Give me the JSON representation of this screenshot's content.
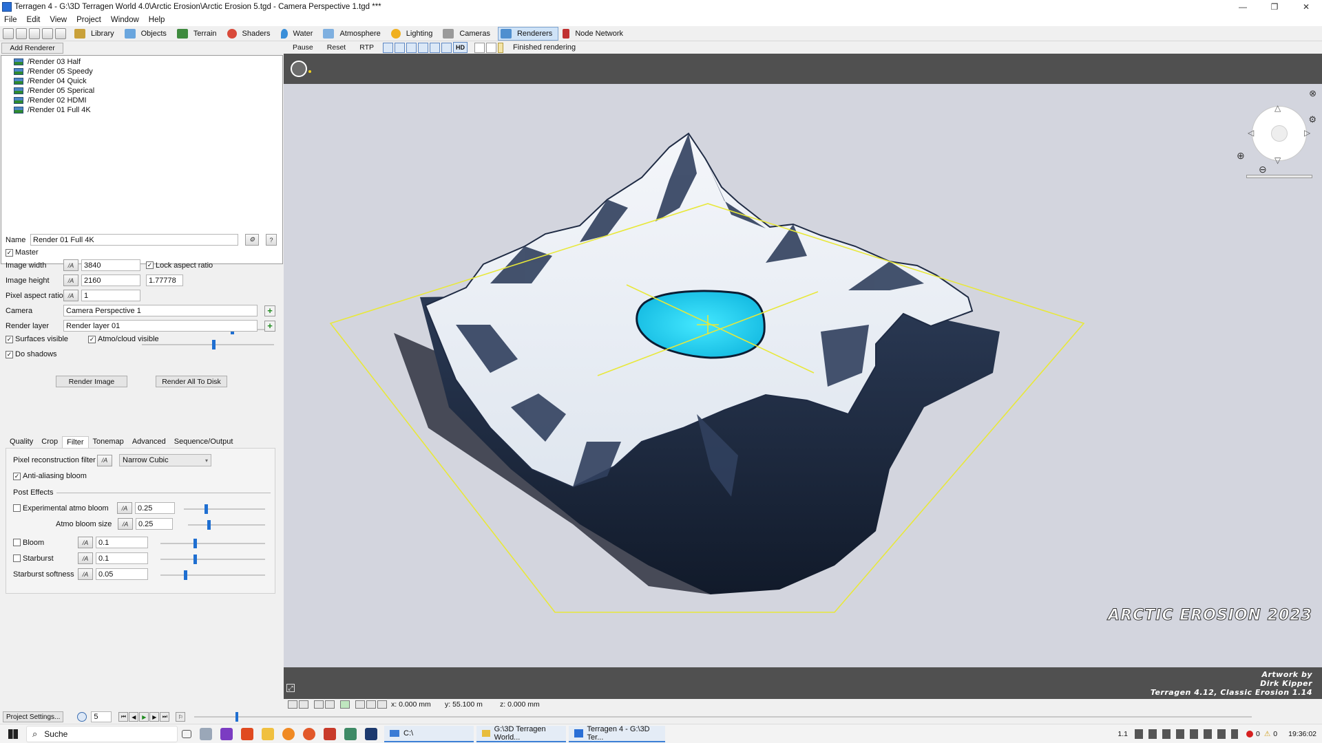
{
  "window": {
    "title": "Terragen 4 - G:\\3D Terragen World 4.0\\Arctic Erosion\\Arctic Erosion 5.tgd - Camera Perspective 1.tgd ***",
    "controls": [
      "—",
      "❐",
      "✕"
    ]
  },
  "menu": [
    "File",
    "Edit",
    "View",
    "Project",
    "Window",
    "Help"
  ],
  "toolbar": {
    "tabs": [
      {
        "label": "Library",
        "icon": "library-icon",
        "color": "#c9a13a"
      },
      {
        "label": "Objects",
        "icon": "objects-icon",
        "color": "#6aa6de"
      },
      {
        "label": "Terrain",
        "icon": "terrain-icon",
        "color": "#3e8a3e"
      },
      {
        "label": "Shaders",
        "icon": "shaders-icon",
        "color": "#d94a3a"
      },
      {
        "label": "Water",
        "icon": "water-icon",
        "color": "#3a8fd9"
      },
      {
        "label": "Atmosphere",
        "icon": "atmosphere-icon",
        "color": "#7fb0e0"
      },
      {
        "label": "Lighting",
        "icon": "lighting-icon",
        "color": "#f0b020"
      },
      {
        "label": "Cameras",
        "icon": "cameras-icon",
        "color": "#9a9a9a"
      },
      {
        "label": "Renderers",
        "icon": "renderers-icon",
        "color": "#4f8fcf",
        "active": true
      },
      {
        "label": "Node Network",
        "icon": "node-network-icon",
        "color": "#c03030"
      }
    ]
  },
  "left": {
    "add_renderer": "Add Renderer",
    "renderers": [
      "/Render 03 Half",
      "/Render 05 Speedy",
      "/Render 04 Quick",
      "/Render 05 Sperical",
      "/Render 02 HDMI",
      "/Render 01 Full 4K"
    ],
    "name_label": "Name",
    "name_value": "Render 01 Full 4K",
    "master_label": "Master",
    "image_width_label": "Image width",
    "image_width": "3840",
    "lock_aspect_label": "Lock aspect ratio",
    "image_height_label": "Image height",
    "image_height": "2160",
    "aspect_value": "1.77778",
    "pixel_aspect_label": "Pixel aspect ratio",
    "pixel_aspect": "1",
    "camera_label": "Camera",
    "camera_value": "Camera Perspective 1",
    "render_layer_label": "Render layer",
    "render_layer_value": "Render layer 01",
    "surfaces_label": "Surfaces visible",
    "atmo_label": "Atmo/cloud visible",
    "shadows_label": "Do shadows",
    "render_image": "Render Image",
    "render_all": "Render All To Disk",
    "tabs": [
      "Quality",
      "Crop",
      "Filter",
      "Tonemap",
      "Advanced",
      "Sequence/Output"
    ],
    "active_tab": "Filter",
    "filter": {
      "pixel_filter_label": "Pixel reconstruction filter",
      "pixel_filter_value": "Narrow Cubic",
      "aa_bloom_label": "Anti-aliasing bloom",
      "post_effects": "Post Effects",
      "exp_atmo_label": "Experimental atmo bloom",
      "exp_atmo_value": "0.25",
      "atmo_size_label": "Atmo bloom size",
      "atmo_size_value": "0.25",
      "bloom_label": "Bloom",
      "bloom_value": "0.1",
      "starburst_label": "Starburst",
      "starburst_value": "0.1",
      "starburst_soft_label": "Starburst softness",
      "starburst_soft_value": "0.05"
    }
  },
  "viewport": {
    "pause": "Pause",
    "reset": "Reset",
    "rtp": "RTP",
    "hd": "HD",
    "status": "Finished rendering",
    "art_title": "ARCTIC EROSION 2023",
    "art_credit_1": "Artwork by",
    "art_credit_2": "Dirk Kipper",
    "art_credit_3": "Terragen 4.12, Classic Erosion 1.14",
    "coord_x": "x: 0.000 mm",
    "coord_y": "y: 55.100 m",
    "coord_z": "z: 0.000 mm"
  },
  "timeline": {
    "project_settings": "Project Settings...",
    "frame": "5"
  },
  "taskbar": {
    "search": "Suche",
    "apps": [
      "C:\\",
      "G:\\3D Terragen World...",
      "Terragen 4 - G:\\3D Ter..."
    ],
    "tray_notif": "0",
    "tray_warn": "0",
    "tray_ver": "1.1",
    "time": "19:36:02"
  }
}
